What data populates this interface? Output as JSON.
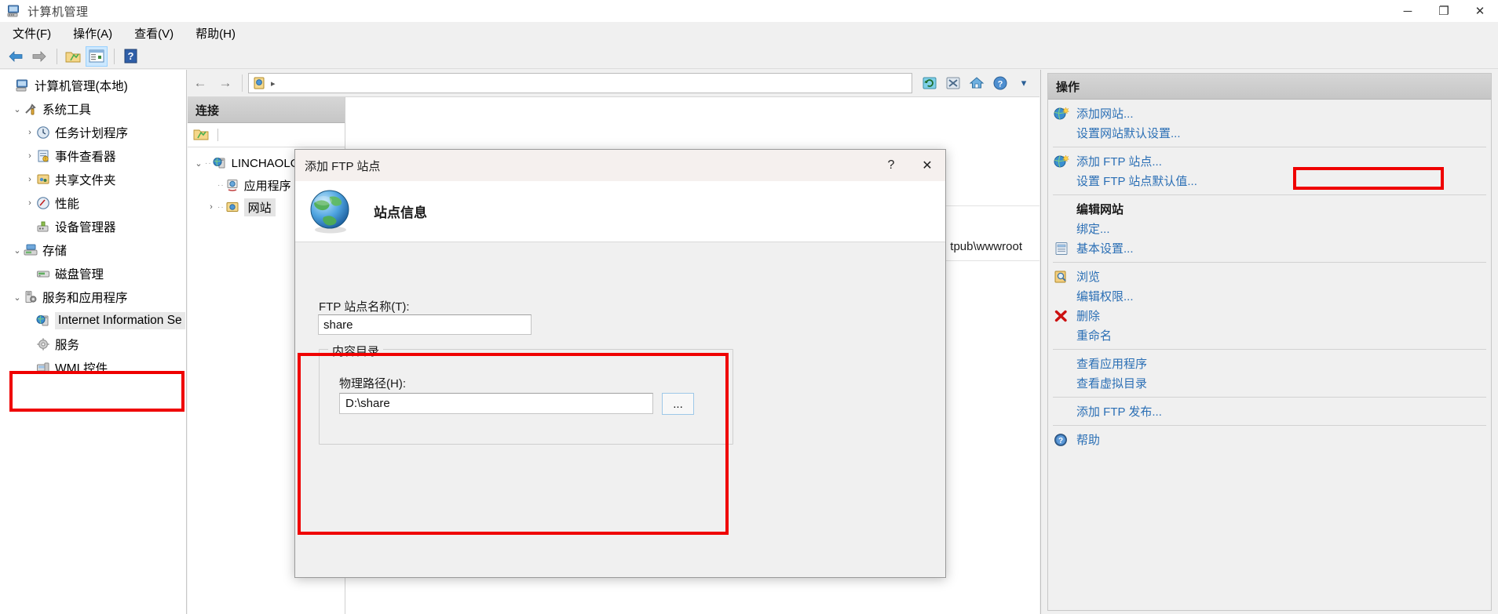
{
  "window": {
    "title": "计算机管理",
    "icon": "computer-management-icon",
    "minimize": "─",
    "maximize": "❐",
    "close": "✕"
  },
  "menubar": {
    "items": [
      {
        "label": "文件(F)",
        "name": "menu-file"
      },
      {
        "label": "操作(A)",
        "name": "menu-action"
      },
      {
        "label": "查看(V)",
        "name": "menu-view"
      },
      {
        "label": "帮助(H)",
        "name": "menu-help"
      }
    ]
  },
  "toolbar": {
    "back": "back-icon",
    "forward": "forward-icon",
    "up": "up-folder-icon",
    "show_hide_console": "show-console-tree-icon",
    "help": "help-icon"
  },
  "tree": {
    "items": [
      {
        "label": "计算机管理(本地)",
        "indent": 0,
        "twisty": "",
        "icon": "computer-icon"
      },
      {
        "label": "系统工具",
        "indent": 1,
        "twisty": "⌄",
        "icon": "tools-icon"
      },
      {
        "label": "任务计划程序",
        "indent": 2,
        "twisty": "›",
        "icon": "clock-icon"
      },
      {
        "label": "事件查看器",
        "indent": 2,
        "twisty": "›",
        "icon": "event-viewer-icon"
      },
      {
        "label": "共享文件夹",
        "indent": 2,
        "twisty": "›",
        "icon": "shared-folder-icon"
      },
      {
        "label": "性能",
        "indent": 2,
        "twisty": "›",
        "icon": "performance-icon"
      },
      {
        "label": "设备管理器",
        "indent": 2,
        "twisty": "",
        "icon": "device-manager-icon"
      },
      {
        "label": "存储",
        "indent": 1,
        "twisty": "⌄",
        "icon": "storage-icon"
      },
      {
        "label": "磁盘管理",
        "indent": 2,
        "twisty": "",
        "icon": "disk-management-icon"
      },
      {
        "label": "服务和应用程序",
        "indent": 1,
        "twisty": "⌄",
        "icon": "services-apps-icon"
      },
      {
        "label": "Internet Information Se",
        "indent": 2,
        "twisty": "",
        "icon": "iis-icon",
        "selected": true
      },
      {
        "label": "服务",
        "indent": 2,
        "twisty": "",
        "icon": "service-gear-icon"
      },
      {
        "label": "WMI 控件",
        "indent": 2,
        "twisty": "",
        "icon": "wmi-icon"
      }
    ]
  },
  "iis": {
    "nav": {
      "back": "←",
      "forward": "→",
      "crumb_icon": "site-icon",
      "crumb_arrow": "▸",
      "refresh": "refresh-icon",
      "stop": "stop-icon",
      "home": "home-icon",
      "help": "help-icon",
      "dropdown": "▾"
    },
    "connections": {
      "header": "连接",
      "toolbar_icon": "connect-icon",
      "nodes": [
        {
          "label": "LINCHAOLO",
          "indent": 0,
          "twisty": "⌄",
          "icon": "server-icon"
        },
        {
          "label": "应用程序",
          "indent": 1,
          "twisty": "",
          "icon": "app-pools-icon"
        },
        {
          "label": "网站",
          "indent": 1,
          "twisty": "›",
          "icon": "sites-folder-icon",
          "selected": true
        }
      ]
    },
    "content": {
      "path_fragment": "tpub\\wwwroot"
    }
  },
  "actions": {
    "header": "操作",
    "items": [
      {
        "label": "添加网站...",
        "icon": "add-website-icon",
        "type": "link",
        "name": "action-add-website"
      },
      {
        "label": "设置网站默认设置...",
        "icon": "",
        "type": "link",
        "name": "action-website-defaults"
      },
      {
        "separator": true
      },
      {
        "label": "添加 FTP 站点...",
        "icon": "add-ftp-site-icon",
        "type": "link",
        "name": "action-add-ftp-site",
        "highlighted": true
      },
      {
        "label": "设置 FTP 站点默认值...",
        "icon": "",
        "type": "link",
        "name": "action-ftp-site-defaults"
      },
      {
        "separator": true
      },
      {
        "label": "编辑网站",
        "icon": "",
        "type": "group",
        "name": "action-group-edit-site"
      },
      {
        "label": "绑定...",
        "icon": "",
        "type": "link",
        "name": "action-bindings"
      },
      {
        "label": "基本设置...",
        "icon": "basic-settings-icon",
        "type": "link",
        "name": "action-basic-settings"
      },
      {
        "separator": true
      },
      {
        "label": "浏览",
        "icon": "browse-icon",
        "type": "link",
        "name": "action-browse"
      },
      {
        "label": "编辑权限...",
        "icon": "",
        "type": "link",
        "name": "action-edit-permissions"
      },
      {
        "label": "删除",
        "icon": "delete-icon",
        "type": "link",
        "name": "action-delete"
      },
      {
        "label": "重命名",
        "icon": "",
        "type": "link",
        "name": "action-rename"
      },
      {
        "separator": true
      },
      {
        "label": "查看应用程序",
        "icon": "",
        "type": "link",
        "name": "action-view-applications"
      },
      {
        "label": "查看虚拟目录",
        "icon": "",
        "type": "link",
        "name": "action-view-virtual-directories"
      },
      {
        "separator": true
      },
      {
        "label": "添加 FTP 发布...",
        "icon": "",
        "type": "link",
        "name": "action-add-ftp-publishing"
      },
      {
        "separator": true
      },
      {
        "label": "帮助",
        "icon": "help-circle-icon",
        "type": "link",
        "name": "action-help"
      }
    ]
  },
  "dialog": {
    "title": "添加 FTP 站点",
    "help_glyph": "?",
    "close_glyph": "✕",
    "header_icon": "globe-icon",
    "header_text": "站点信息",
    "site_name_label": "FTP 站点名称(T):",
    "site_name_value": "share",
    "site_name_placeholder": "",
    "group_title": "内容目录",
    "physical_path_label": "物理路径(H):",
    "physical_path_value": "D:\\share",
    "physical_path_placeholder": "",
    "browse_button_label": "..."
  },
  "highlights": {
    "color": "#ef0000"
  }
}
